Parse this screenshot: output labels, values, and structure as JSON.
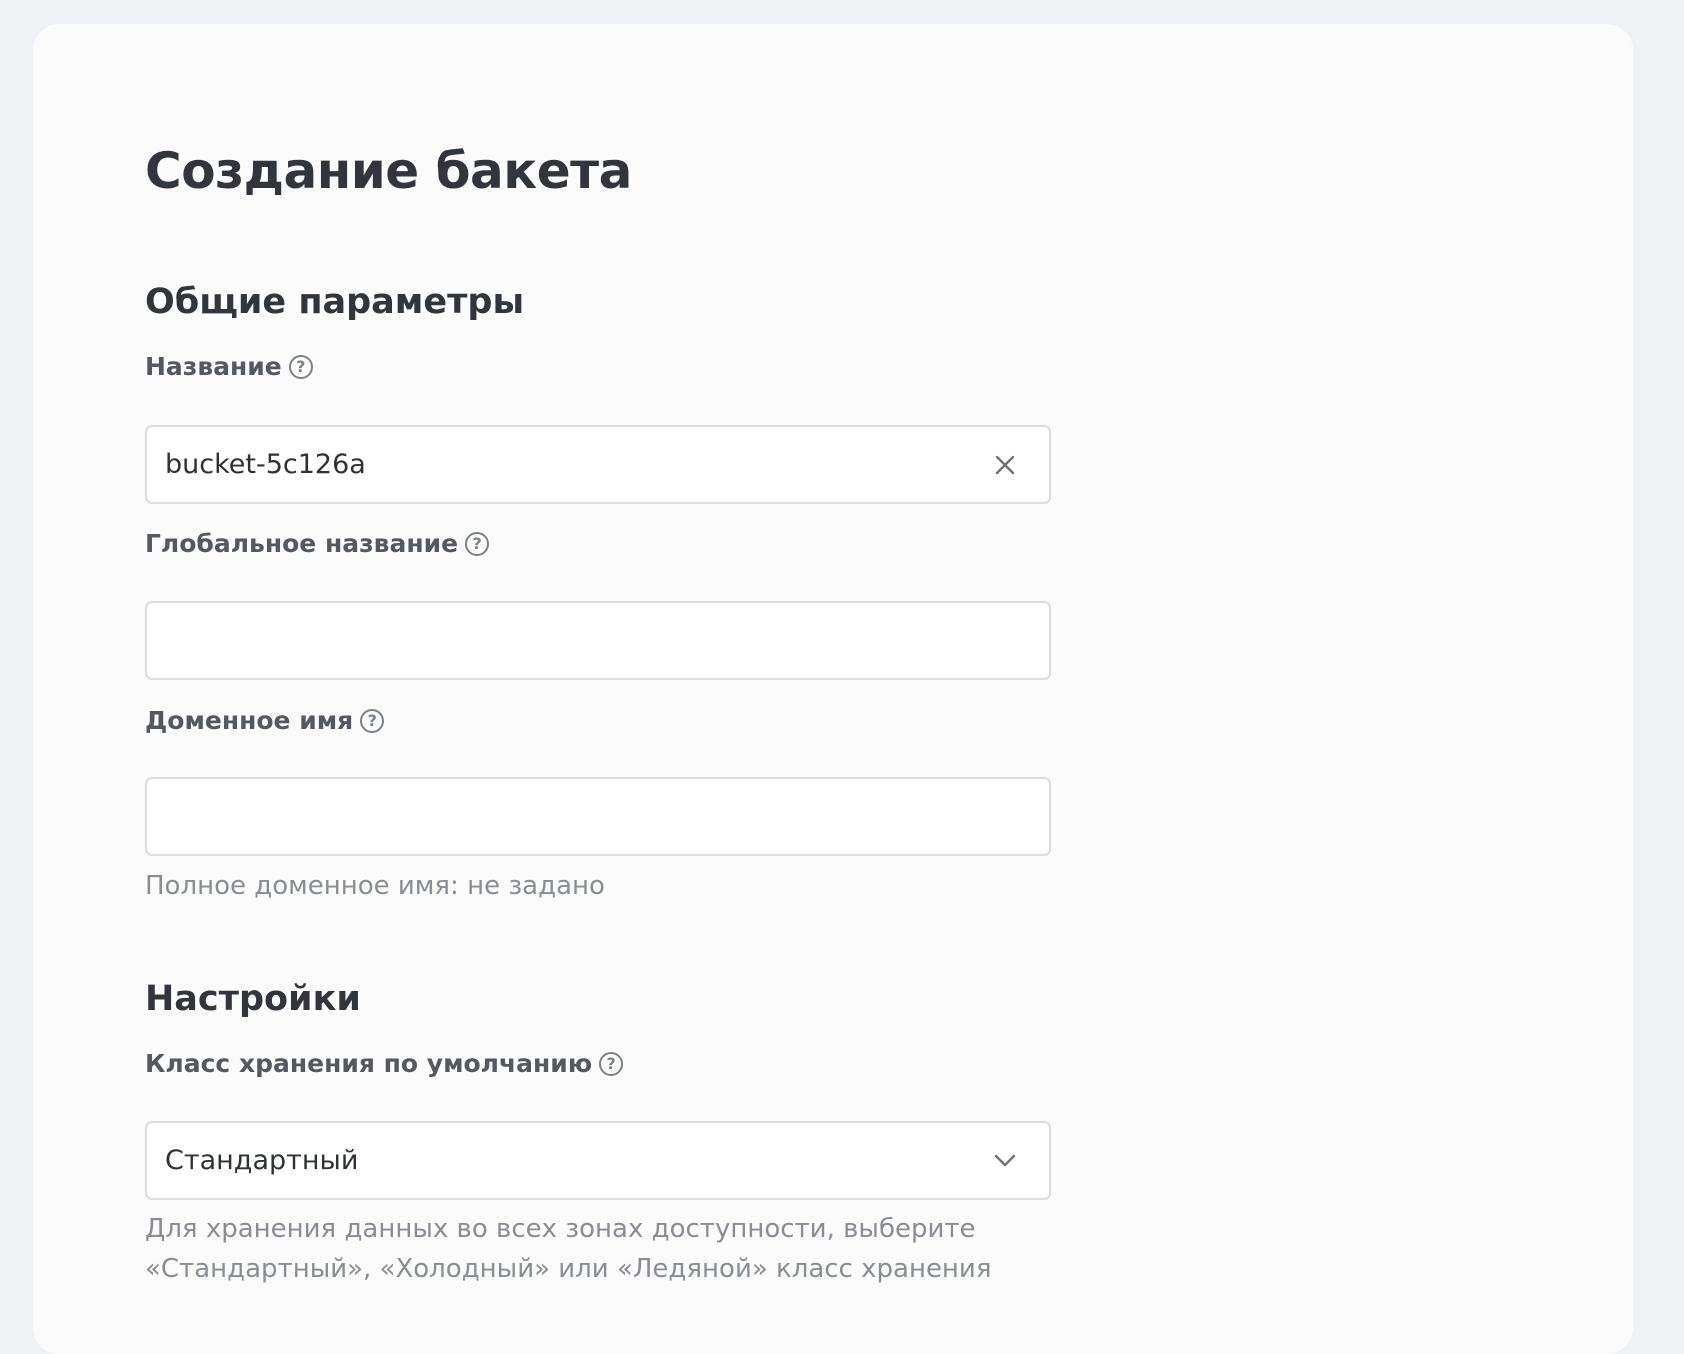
{
  "page": {
    "title": "Создание бакета"
  },
  "general": {
    "section_title": "Общие параметры",
    "name": {
      "label": "Название",
      "value": "bucket-5c126a"
    },
    "global_name": {
      "label": "Глобальное название",
      "value": ""
    },
    "domain_name": {
      "label": "Доменное имя",
      "value": "",
      "hint": "Полное доменное имя: не задано"
    }
  },
  "settings": {
    "section_title": "Настройки",
    "storage_class": {
      "label": "Класс хранения по умолчанию",
      "selected": "Стандартный",
      "hint_line1": "Для хранения данных во всех зонах доступности, выберите",
      "hint_line2": "«Стандартный», «Холодный» или «Ледяной» класс хранения"
    }
  },
  "icons": {
    "help": "help-circle-icon",
    "clear": "close-icon",
    "dropdown": "chevron-down-icon"
  },
  "colors": {
    "background": "#f0f1f4",
    "card": "#fbfbfc",
    "text_primary": "#33353c",
    "text_label": "#55585f",
    "text_hint": "#8a8d93",
    "input_border": "#dcdde1"
  }
}
